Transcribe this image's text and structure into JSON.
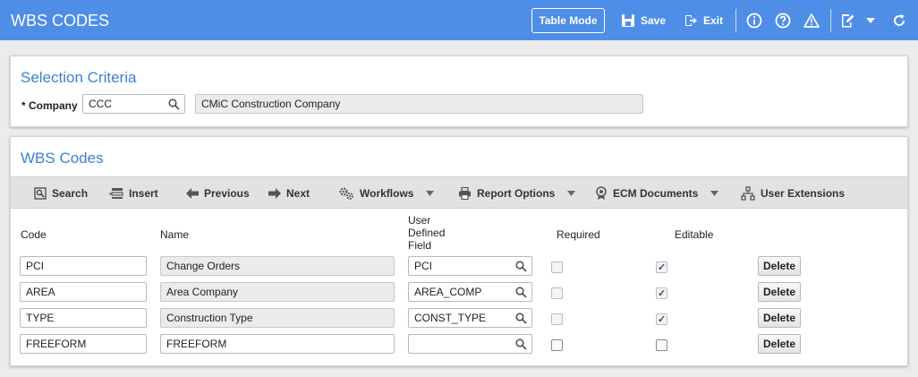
{
  "header": {
    "title": "WBS CODES",
    "table_mode_label": "Table Mode",
    "save_label": "Save",
    "exit_label": "Exit"
  },
  "selection": {
    "title": "Selection Criteria",
    "company_label": "* Company",
    "company_code": "CCC",
    "company_name": "CMiC Construction Company"
  },
  "wbs": {
    "title": "WBS Codes",
    "toolbar": {
      "search": "Search",
      "insert": "Insert",
      "previous": "Previous",
      "next": "Next",
      "workflows": "Workflows",
      "report_options": "Report Options",
      "ecm_documents": "ECM Documents",
      "user_extensions": "User Extensions"
    },
    "columns": {
      "code": "Code",
      "name": "Name",
      "udf_line1": "User",
      "udf_line2": "Defined",
      "udf_line3": "Field",
      "required": "Required",
      "editable": "Editable"
    },
    "delete_label": "Delete",
    "rows": [
      {
        "code": "PCI",
        "name": "Change Orders",
        "udf": "PCI",
        "required": false,
        "editable": true
      },
      {
        "code": "AREA",
        "name": "Area Company",
        "udf": "AREA_COMP",
        "required": false,
        "editable": true
      },
      {
        "code": "TYPE",
        "name": "Construction Type",
        "udf": "CONST_TYPE",
        "required": false,
        "editable": true
      },
      {
        "code": "FREEFORM",
        "name": "FREEFORM",
        "udf": "",
        "required": false,
        "editable": false
      }
    ]
  },
  "colors": {
    "header_bg": "#4f8ee6",
    "panel_title": "#3d7fd6"
  }
}
